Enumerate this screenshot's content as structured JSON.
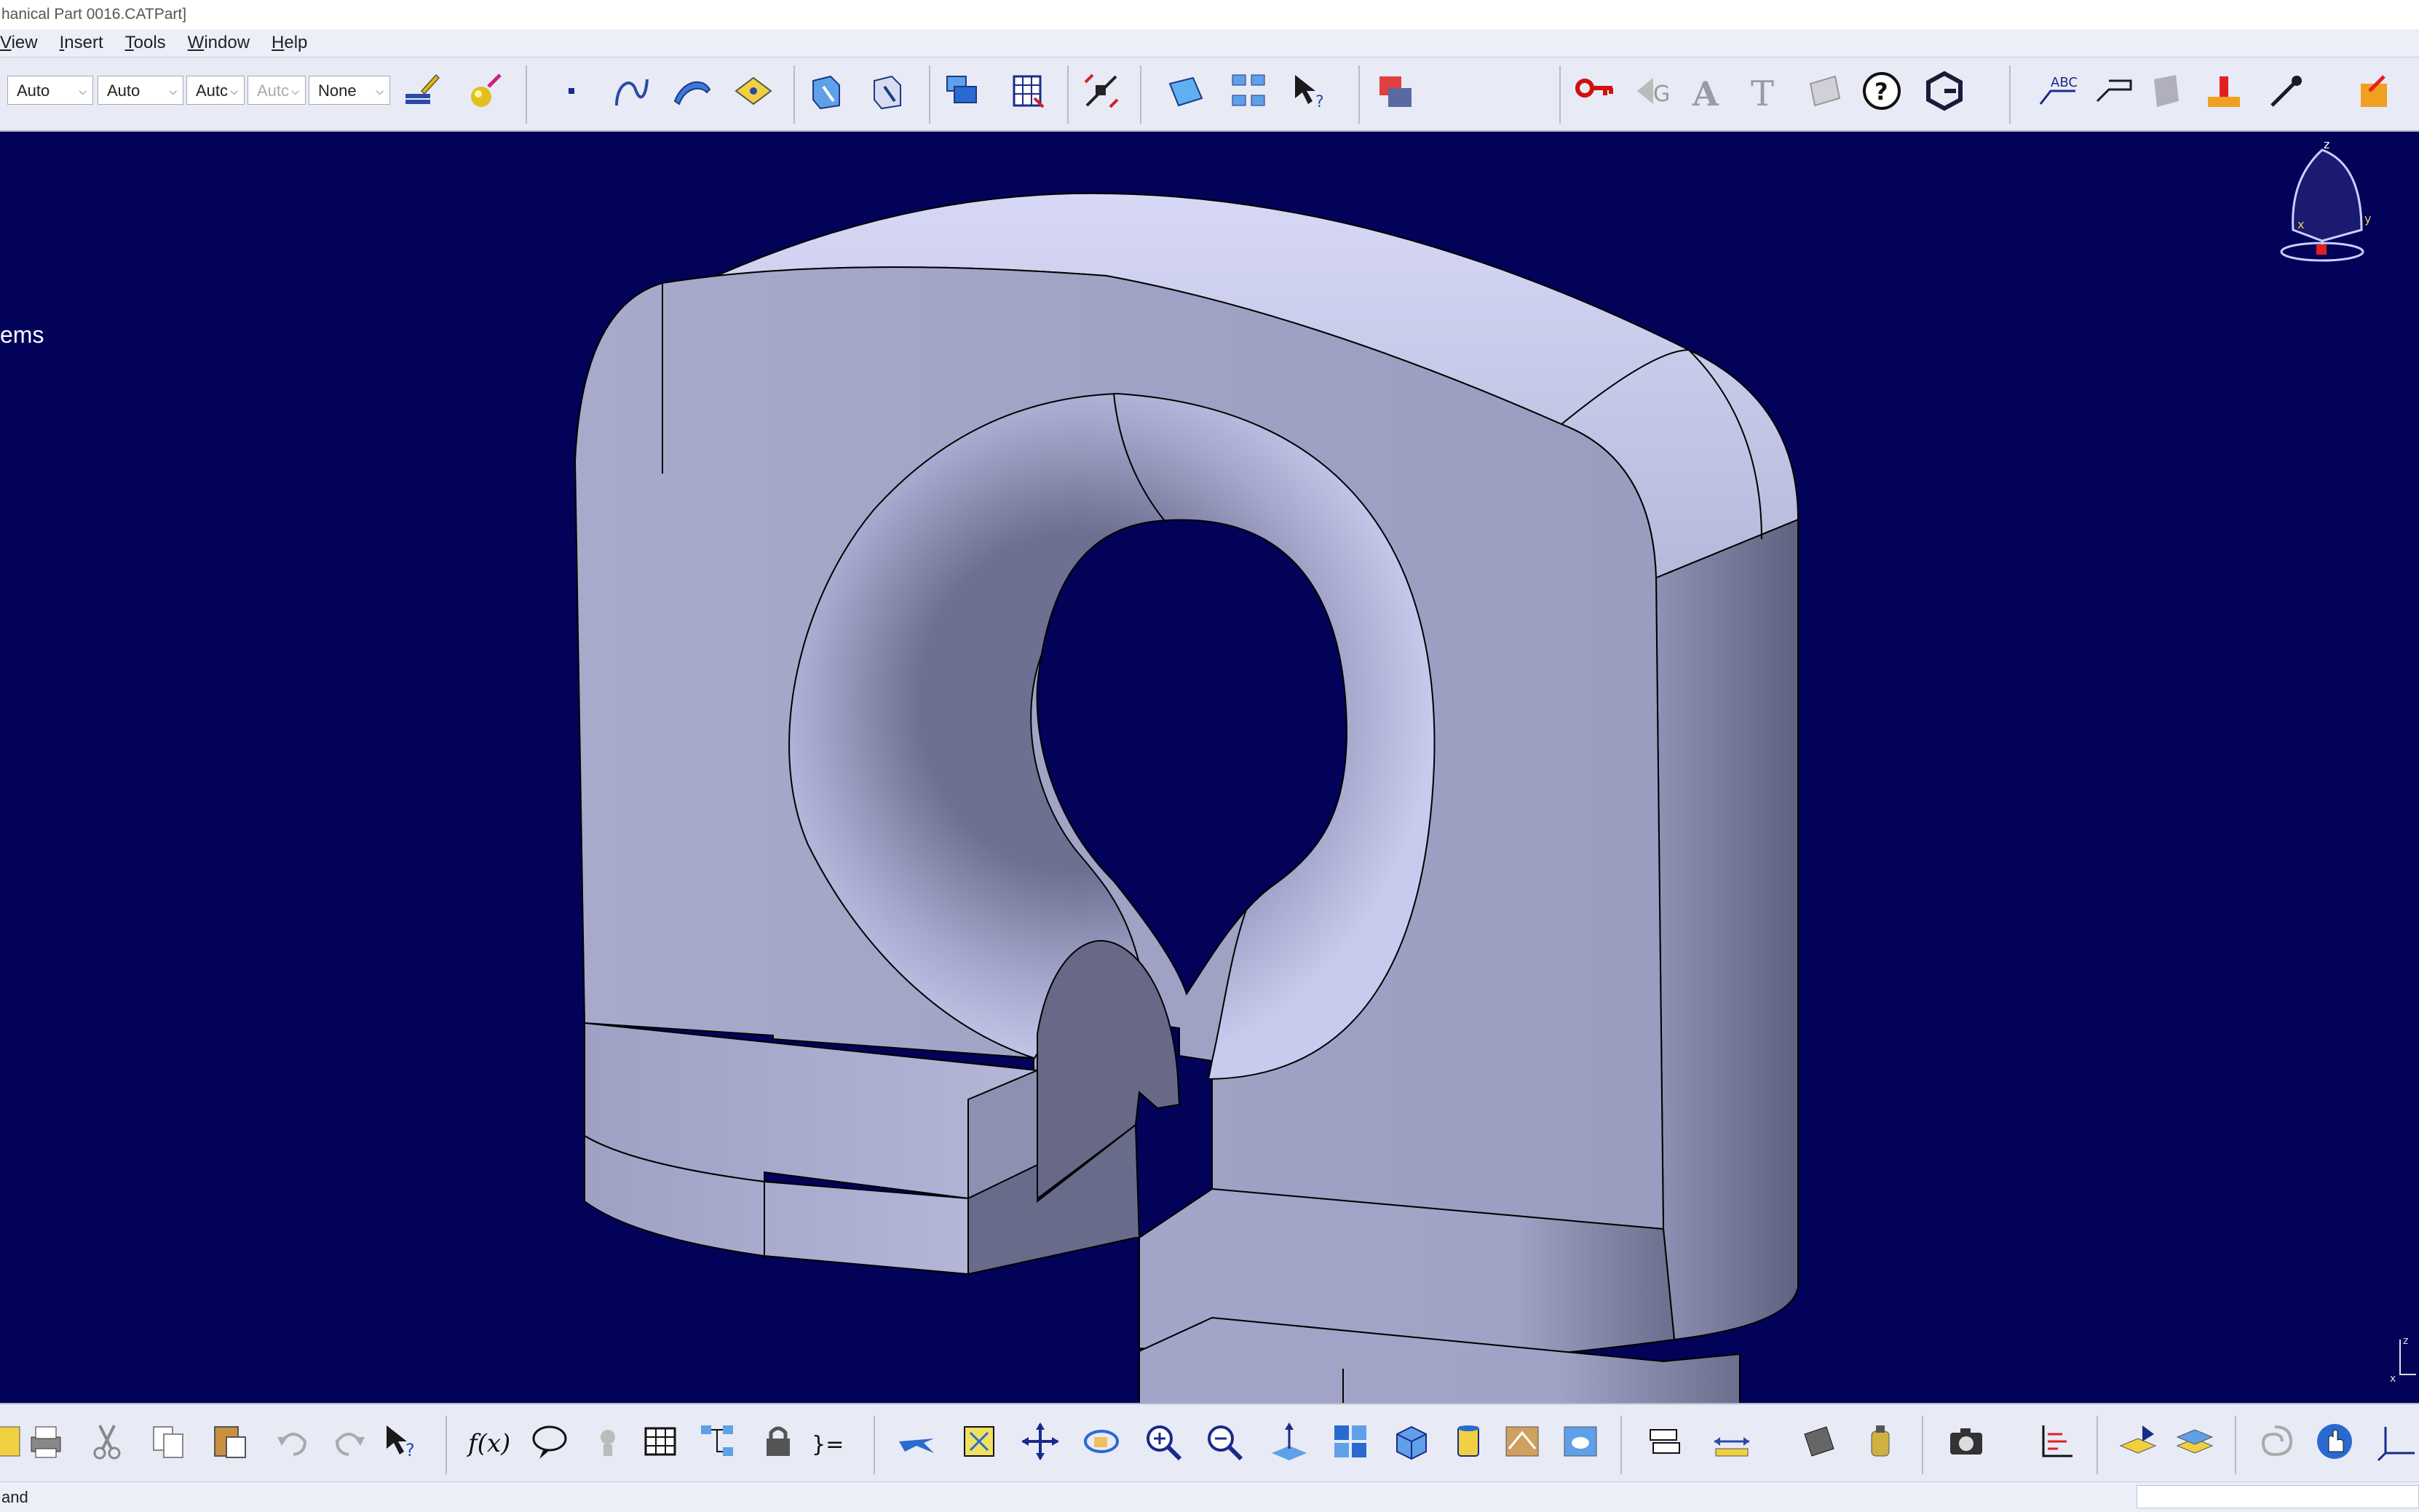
{
  "window": {
    "title": "hanical Part 0016.CATPart]"
  },
  "menu": {
    "items": [
      {
        "label": "View",
        "underline": "V"
      },
      {
        "label": "Insert",
        "underline": "I"
      },
      {
        "label": "Tools",
        "underline": "T"
      },
      {
        "label": "Window",
        "underline": "W"
      },
      {
        "label": "Help",
        "underline": "H"
      }
    ]
  },
  "graphic_properties": {
    "combo1": "Auto",
    "combo2": "Auto",
    "combo3": "Autc",
    "combo4": "Autc",
    "combo5": "None"
  },
  "viewport": {
    "background": "#020258",
    "tree_text": "ems",
    "compass_labels": {
      "z": "z",
      "x": "x",
      "y": "y"
    }
  },
  "status": {
    "text": "and"
  },
  "colors": {
    "part_face": "#a9abcc",
    "part_light": "#cfd1ef",
    "part_shadow": "#6b6d8a",
    "accent_red": "#e02020"
  }
}
